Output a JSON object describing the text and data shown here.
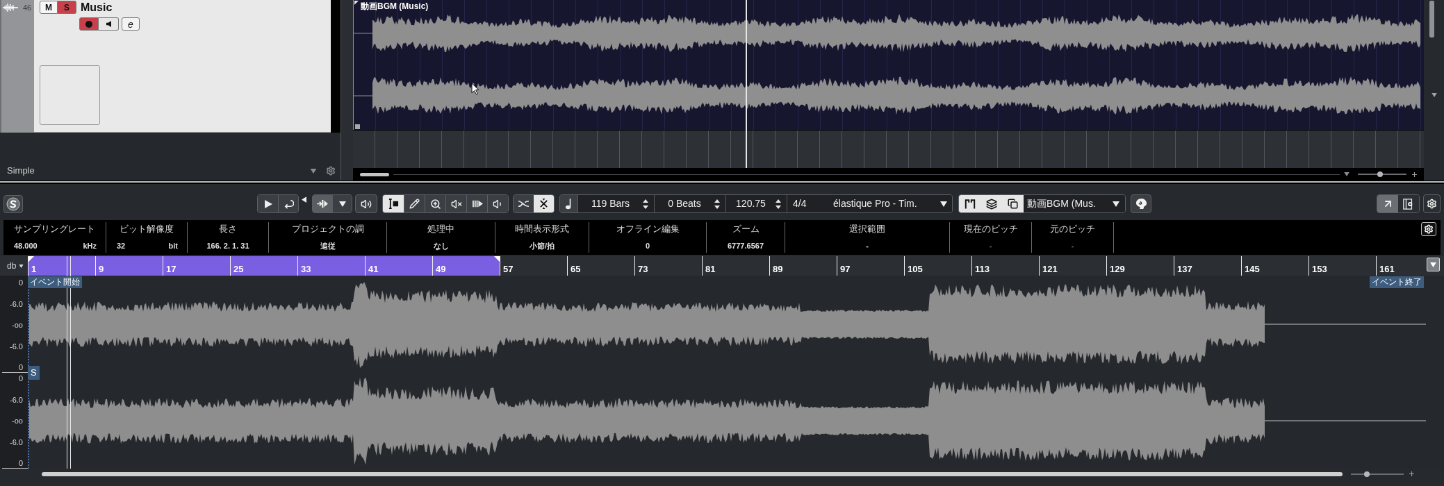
{
  "track": {
    "number": "46",
    "name": "Music",
    "mute": {
      "label": "M",
      "on": false
    },
    "solo": {
      "label": "S",
      "on": true
    },
    "record": {
      "on": true
    },
    "monitor": {
      "on": false
    },
    "edit": {
      "label": "e"
    }
  },
  "track_list": {
    "preset": "Simple"
  },
  "arrangement": {
    "event": {
      "title": "動画BGM (Music)"
    },
    "zoom": {
      "level": 0.45
    }
  },
  "editor": {
    "toolbar": {
      "tools": [
        {
          "selected": true
        },
        {
          "selected": false
        },
        {
          "selected": false
        },
        {
          "selected": false
        },
        {
          "selected": false
        },
        {
          "selected": false
        }
      ],
      "snap": [
        {
          "selected": false
        },
        {
          "selected": true
        }
      ],
      "fields": [
        {
          "kind": "spin",
          "value": "119 Bars"
        },
        {
          "kind": "spin",
          "value": "0 Beats"
        },
        {
          "kind": "spin",
          "value": "120.75"
        },
        {
          "kind": "text",
          "value": "4/4"
        },
        {
          "kind": "dropdown",
          "value": "élastique Pro - Tim."
        }
      ],
      "views": [
        {
          "selected": true
        },
        {
          "selected": true
        },
        {
          "selected": true
        }
      ],
      "event_selector": "動画BGM (Mus.",
      "window_buttons": [
        {
          "selected": true
        },
        {
          "selected": false
        }
      ]
    },
    "info_line": [
      {
        "label": "サンプリングレート",
        "value": "48.000",
        "unit": "kHz",
        "disabled": false
      },
      {
        "label": "ビット解像度",
        "value": "32",
        "unit": "bit",
        "disabled": false
      },
      {
        "label": "長さ",
        "value": "166. 2. 1. 31",
        "disabled": false
      },
      {
        "label": "プロジェクトの調",
        "value": "追従",
        "disabled": false
      },
      {
        "label": "処理中",
        "value": "なし",
        "disabled": false
      },
      {
        "label": "時間表示形式",
        "value": "小節/拍",
        "disabled": false
      },
      {
        "label": "オフライン編集",
        "value": "0",
        "disabled": false
      },
      {
        "label": "ズーム",
        "value": "6777.6567",
        "disabled": false
      },
      {
        "label": "選択範囲",
        "value": "-",
        "disabled": false
      },
      {
        "label": "現在のピッチ",
        "value": "-",
        "disabled": true
      },
      {
        "label": "元のピッチ",
        "value": "-",
        "disabled": true
      }
    ],
    "ruler": {
      "unit": "db",
      "bars": [
        {
          "label": "1",
          "in_range": true
        },
        {
          "label": "9",
          "in_range": true
        },
        {
          "label": "17",
          "in_range": true
        },
        {
          "label": "25",
          "in_range": true
        },
        {
          "label": "33",
          "in_range": true
        },
        {
          "label": "41",
          "in_range": true
        },
        {
          "label": "49",
          "in_range": true
        },
        {
          "label": "57",
          "in_range": false
        },
        {
          "label": "65",
          "in_range": false
        },
        {
          "label": "73",
          "in_range": false
        },
        {
          "label": "81",
          "in_range": false
        },
        {
          "label": "89",
          "in_range": false
        },
        {
          "label": "97",
          "in_range": false
        },
        {
          "label": "105",
          "in_range": false
        },
        {
          "label": "113",
          "in_range": false
        },
        {
          "label": "121",
          "in_range": false
        },
        {
          "label": "129",
          "in_range": false
        },
        {
          "label": "137",
          "in_range": false
        },
        {
          "label": "145",
          "in_range": false
        },
        {
          "label": "153",
          "in_range": false
        },
        {
          "label": "161",
          "in_range": false
        }
      ]
    },
    "waveform": {
      "event_start": "イベント開始",
      "event_end": "イベント終了",
      "snap_marker": "S",
      "channels": [
        {
          "scale": [
            "0",
            "-6.0",
            "-oo",
            "-6.0",
            "0"
          ]
        },
        {
          "scale": [
            "0",
            "-6.0",
            "-oo",
            "-6.0",
            "0"
          ]
        }
      ]
    },
    "zoom": {
      "level": 0.3
    }
  }
}
